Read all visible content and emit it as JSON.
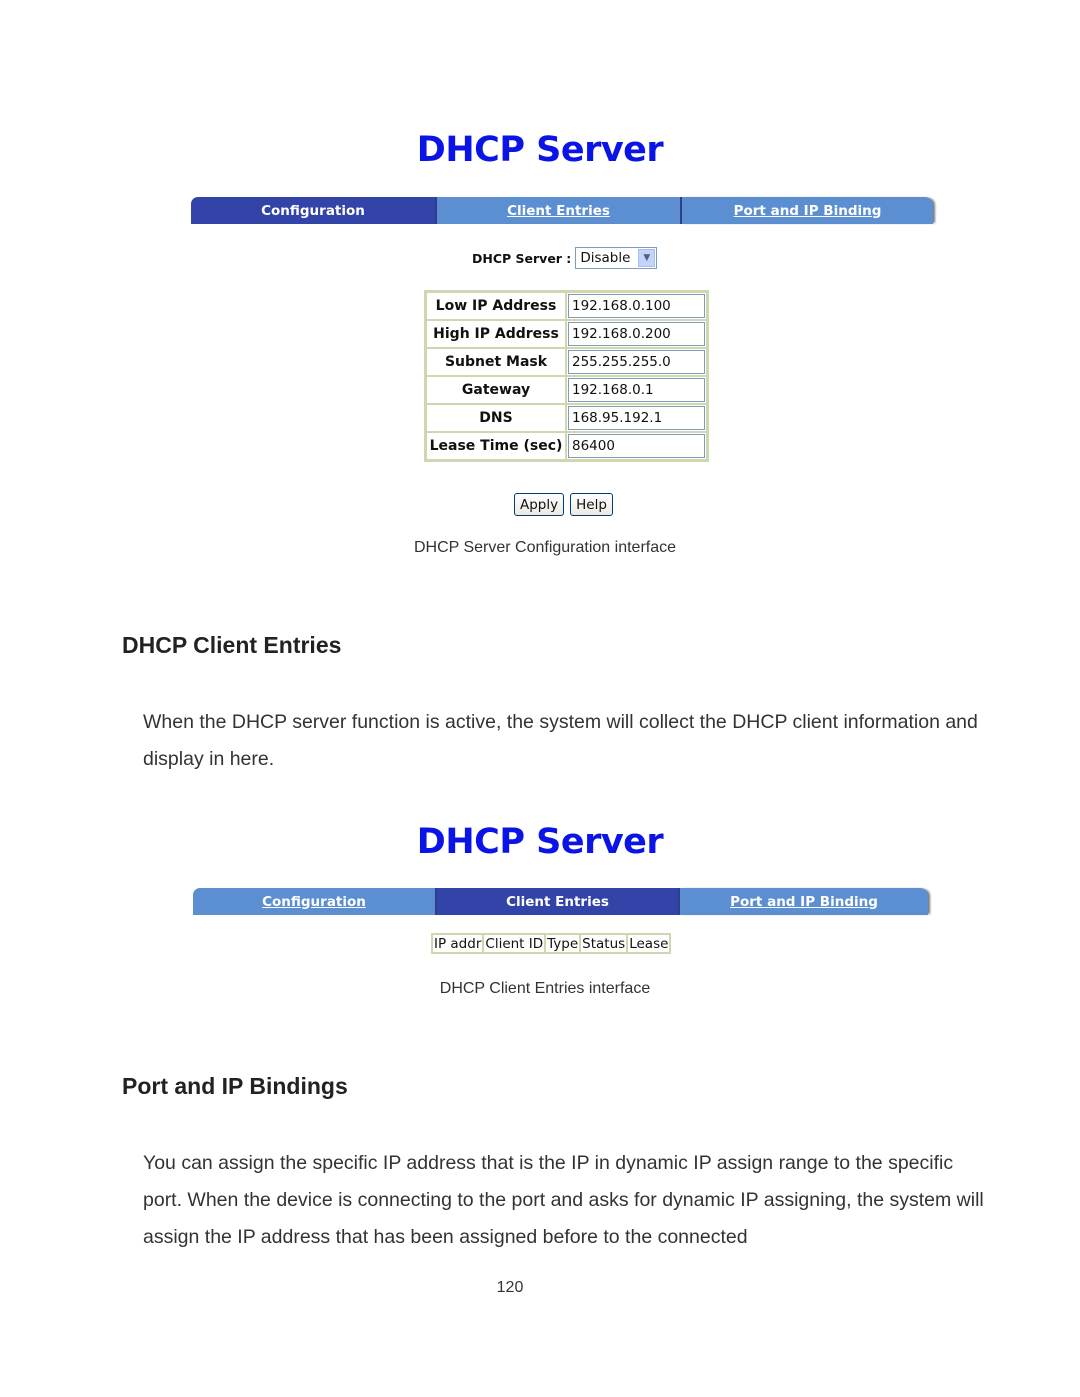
{
  "figure1": {
    "title": "DHCP Server",
    "tabs": [
      {
        "label": "Configuration",
        "active": true
      },
      {
        "label": "Client Entries",
        "active": false
      },
      {
        "label": "Port and IP Binding",
        "active": false
      }
    ],
    "server_label": "DHCP Server :",
    "server_value": "Disable",
    "fields": [
      {
        "label": "Low IP Address",
        "value": "192.168.0.100"
      },
      {
        "label": "High IP Address",
        "value": "192.168.0.200"
      },
      {
        "label": "Subnet Mask",
        "value": "255.255.255.0"
      },
      {
        "label": "Gateway",
        "value": "192.168.0.1"
      },
      {
        "label": "DNS",
        "value": "168.95.192.1"
      },
      {
        "label": "Lease Time (sec)",
        "value": "86400"
      }
    ],
    "apply_label": "Apply",
    "help_label": "Help",
    "caption": "DHCP Server Configuration interface"
  },
  "section_client": {
    "heading": "DHCP Client Entries",
    "paragraph": "When the DHCP server function is active, the system will collect the DHCP client information and display in here."
  },
  "figure2": {
    "title": "DHCP Server",
    "tabs": [
      {
        "label": "Configuration",
        "active": false
      },
      {
        "label": "Client Entries",
        "active": true
      },
      {
        "label": "Port and IP Binding",
        "active": false
      }
    ],
    "columns": [
      "IP addr",
      "Client ID",
      "Type",
      "Status",
      "Lease"
    ],
    "caption": "DHCP Client Entries interface"
  },
  "section_binding": {
    "heading": "Port and IP Bindings",
    "paragraph": "You can assign the specific IP address that is the IP in dynamic IP assign range to the specific port. When the device is connecting to the port and asks for dynamic IP assigning, the system will assign the IP address that has been assigned before to the connected"
  },
  "page_number": "120"
}
